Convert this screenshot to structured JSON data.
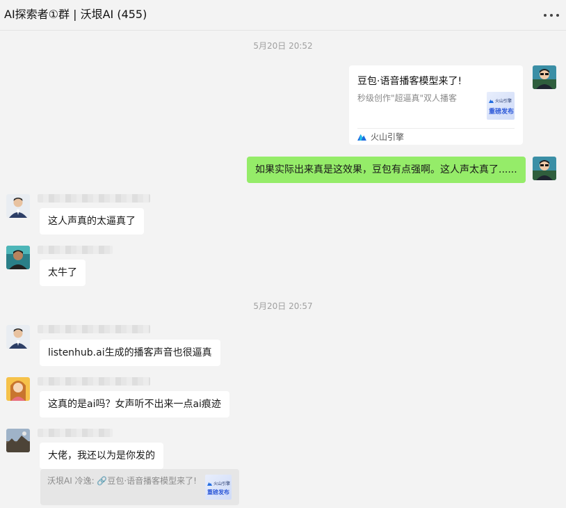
{
  "chat": {
    "title": "AI探索者①群 | 沃垠AI (455)"
  },
  "timestamps": [
    "5月20日 20:52",
    "5月20日 20:57"
  ],
  "card": {
    "title": "豆包·语音播客模型来了!",
    "desc": "秒级创作\"超逼真\"双人播客",
    "source": "火山引擎",
    "thumb_brand": "火山引擎",
    "thumb_text": "重磅发布"
  },
  "messages": [
    {
      "text": "如果实际出来真是这效果，豆包有点强啊。这人声太真了......"
    },
    {
      "text": "这人声真的太逼真了"
    },
    {
      "text": "太牛了"
    },
    {
      "text": "listenhub.ai生成的播客声音也很逼真"
    },
    {
      "text": "这真的是ai吗？女声听不出来一点ai痕迹"
    },
    {
      "text": "大佬，我还以为是你发的"
    }
  ],
  "quote": {
    "text": "沃垠AI 冷逸: 🔗豆包·语音播客模型来了!",
    "thumb_brand": "火山引擎",
    "thumb_text": "重磅发布"
  },
  "colors": {
    "self_bubble": "#95ec69",
    "other_bubble": "#ffffff",
    "background": "#f3f3f3"
  }
}
